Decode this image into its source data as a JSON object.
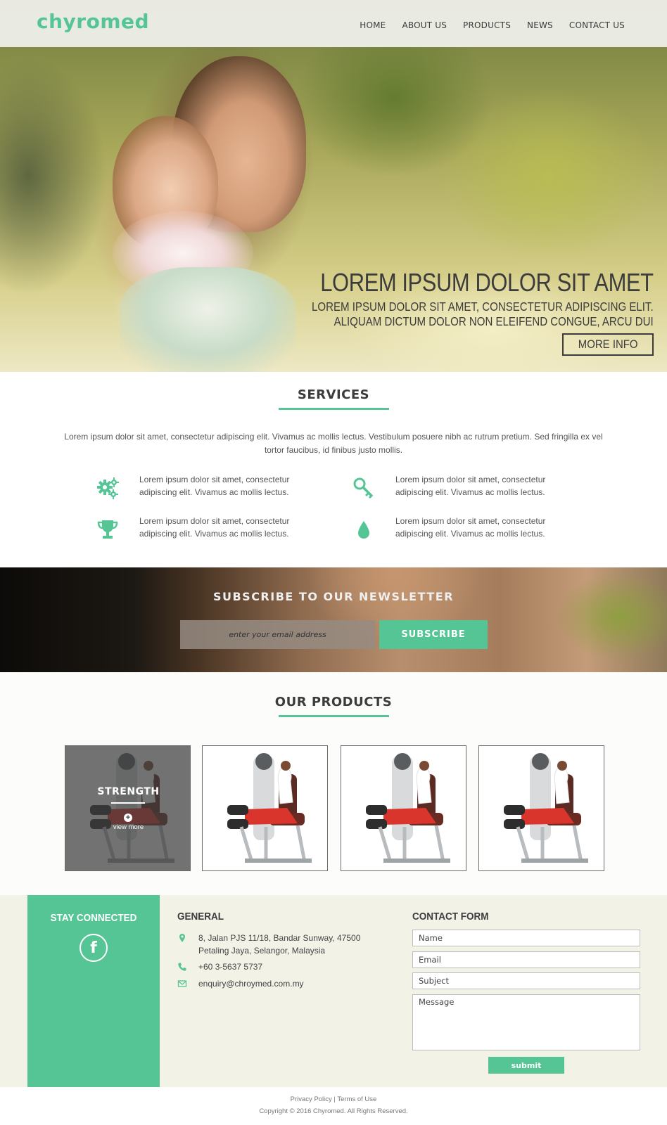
{
  "brand": {
    "logo": "chyromed",
    "accent_color": "#55c596"
  },
  "nav": {
    "items": [
      {
        "label": "HOME"
      },
      {
        "label": "ABOUT US"
      },
      {
        "label": "PRODUCTS"
      },
      {
        "label": "NEWS"
      },
      {
        "label": "CONTACT US"
      }
    ]
  },
  "hero": {
    "title": "LOREM IPSUM DOLOR SIT AMET",
    "subtitle_line1": "LOREM IPSUM DOLOR SIT AMET, CONSECTETUR ADIPISCING ELIT.",
    "subtitle_line2": "ALIQUAM DICTUM  DOLOR NON ELEIFEND CONGUE, ARCU DUI",
    "button_label": "MORE INFO"
  },
  "services": {
    "title": "SERVICES",
    "intro": "Lorem ipsum dolor sit amet, consectetur adipiscing elit. Vivamus ac mollis lectus. Vestibulum posuere nibh ac rutrum pretium. Sed fringilla ex vel tortor faucibus, id finibus justo mollis.",
    "items": [
      {
        "icon": "gears-icon",
        "text": "Lorem ipsum dolor sit amet, consectetur adipiscing elit. Vivamus ac mollis lectus."
      },
      {
        "icon": "key-icon",
        "text": "Lorem ipsum dolor sit amet, consectetur adipiscing elit. Vivamus ac mollis lectus."
      },
      {
        "icon": "trophy-icon",
        "text": "Lorem ipsum dolor sit amet, consectetur adipiscing elit. Vivamus ac mollis lectus."
      },
      {
        "icon": "drop-icon",
        "text": "Lorem ipsum dolor sit amet, consectetur adipiscing elit. Vivamus ac mollis lectus."
      }
    ]
  },
  "newsletter": {
    "title": "SUBSCRIBE TO OUR NEWSLETTER",
    "input_placeholder": "enter your email address",
    "button_label": "SUBSCRIBE"
  },
  "products": {
    "title": "OUR PRODUCTS",
    "hover_label": "STRENGTH",
    "hover_more": "view more",
    "cards": 4
  },
  "footer": {
    "stay_connected": "STAY CONNECTED",
    "social_icon": "facebook-icon",
    "general": {
      "title": "GENERAL",
      "address_line1": "8, Jalan PJS 11/18, Bandar Sunway, 47500",
      "address_line2": "Petaling Jaya, Selangor, Malaysia",
      "phone": "+60 3-5637 5737",
      "email": "enquiry@chroymed.com.my"
    },
    "contact_form": {
      "title": "CONTACT FORM",
      "name_placeholder": "Name",
      "email_placeholder": "Email",
      "subject_placeholder": "Subject",
      "message_placeholder": "Message",
      "submit_label": "submit"
    }
  },
  "bottom": {
    "privacy": "Privacy Policy",
    "separator": "|",
    "terms": "Terms of Use",
    "copyright": "Copyright © 2016 Chyromed. All Rights Reserved."
  }
}
